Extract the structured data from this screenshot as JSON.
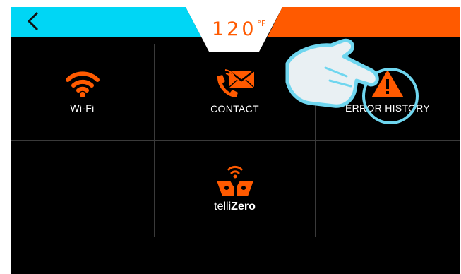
{
  "header": {
    "temperature_value": "120",
    "temperature_unit": "°F",
    "left_color": "#00d6f5",
    "right_color": "#ff5a00",
    "center_color": "#ffffff"
  },
  "tiles": [
    {
      "id": "wifi",
      "label": "Wi-Fi",
      "icon": "wifi-icon"
    },
    {
      "id": "contact",
      "label": "CONTACT",
      "icon": "phone-mail-icon"
    },
    {
      "id": "error-history",
      "label": "ERROR HISTORY",
      "icon": "warning-icon"
    },
    {
      "id": "tellizero",
      "brand_light": "telli",
      "brand_bold": "Zero",
      "icon": "tellizero-logo-icon"
    }
  ],
  "accent_color": "#ff5a00"
}
